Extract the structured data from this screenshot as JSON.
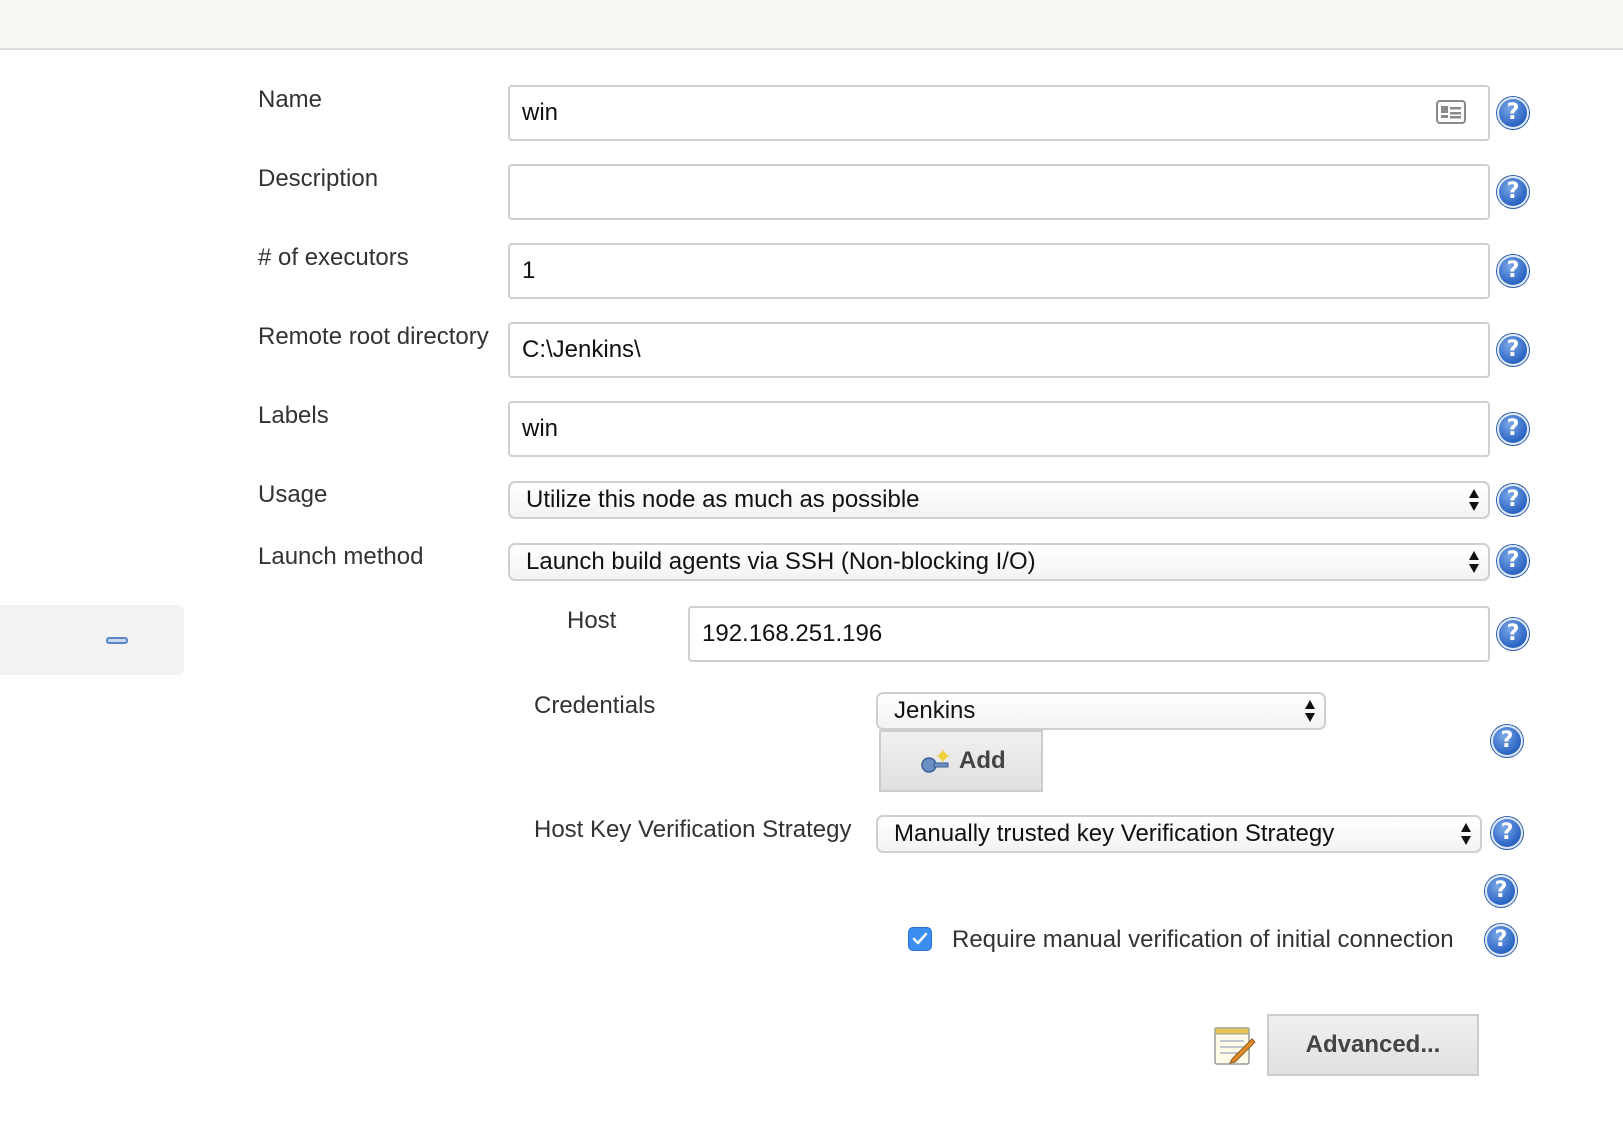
{
  "form": {
    "name": {
      "label": "Name",
      "value": "win"
    },
    "description": {
      "label": "Description",
      "value": ""
    },
    "executors": {
      "label": "# of executors",
      "value": "1"
    },
    "remote_root": {
      "label": "Remote root directory",
      "value": "C:\\Jenkins\\"
    },
    "labels": {
      "label": "Labels",
      "value": "win"
    },
    "usage": {
      "label": "Usage",
      "selected": "Utilize this node as much as possible"
    },
    "launch_method": {
      "label": "Launch method",
      "selected": "Launch build agents via SSH (Non-blocking I/O)"
    },
    "host": {
      "label": "Host",
      "value": "192.168.251.196"
    },
    "credentials": {
      "label": "Credentials",
      "selected": "Jenkins",
      "add_label": "Add"
    },
    "host_key_strategy": {
      "label": "Host Key Verification Strategy",
      "selected": "Manually trusted key Verification Strategy"
    },
    "manual_verification": {
      "label": "Require manual verification of initial connection",
      "checked": true
    },
    "advanced_label": "Advanced..."
  },
  "icons": {
    "help": "help-icon",
    "collapse": "minus-icon",
    "contact_card": "contact-card-icon",
    "key": "key-icon",
    "notepad": "notepad-icon",
    "help_glyph": "?"
  },
  "colors": {
    "help_blue": "#2e67c5",
    "checkbox_blue": "#3b8ef0",
    "top_bar": "#f7f9f4"
  }
}
